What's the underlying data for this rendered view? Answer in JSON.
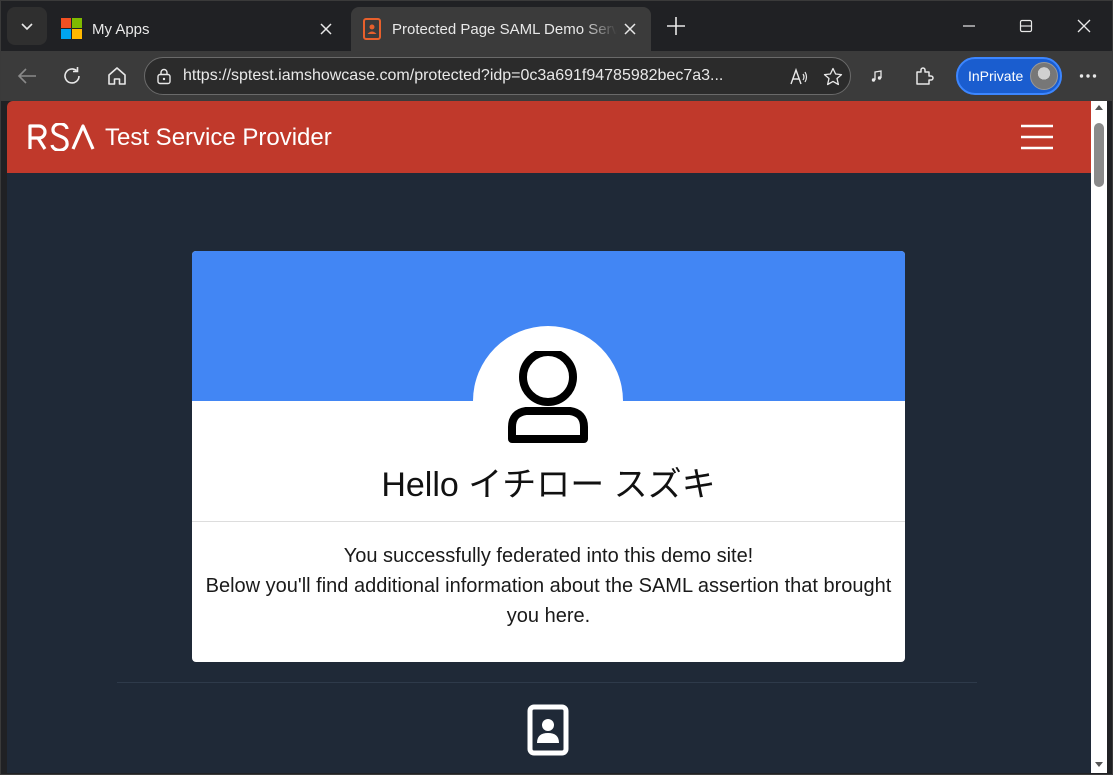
{
  "browser": {
    "tabs": [
      {
        "title": "My Apps",
        "icon": "microsoft-logo-icon",
        "active": false
      },
      {
        "title": "Protected Page SAML Demo Service Provider",
        "icon": "id-badge-icon",
        "active": true
      }
    ],
    "address_bar": {
      "url": "https://sptest.iamshowcase.com/protected?idp=0c3a691f94785982bec7a3..."
    },
    "profile": {
      "label": "InPrivate"
    },
    "accent_color": "#1a5dcf"
  },
  "page": {
    "navbar": {
      "logo_text": "RSA",
      "brand": "Test Service Provider",
      "color": "#c0392b"
    },
    "card": {
      "banner_color": "#4286f4",
      "greeting": "Hello イチロー スズキ",
      "message_line1": "You successfully federated into this demo site!",
      "message_line2": "Below you'll find additional information about the SAML assertion that brought you here."
    },
    "background_color": "#1f2937"
  }
}
